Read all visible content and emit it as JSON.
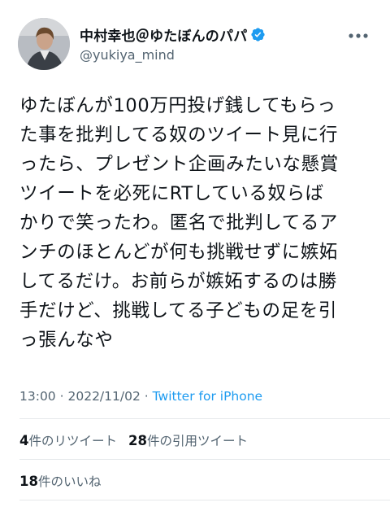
{
  "user": {
    "display_name": "中村幸也＠ゆたぼんのパパ",
    "handle": "@yukiya_mind",
    "verified": true
  },
  "tweet": {
    "text": "ゆたぼんが100万円投げ銭してもらっ\nた事を批判してる奴のツイート見に行\nったら、プレゼント企画みたいな懸賞\nツイートを必死にRTしている奴らば\nかりで笑ったわ。匿名で批判してるア\nンチのほとんどが何も挑戦せずに嫉妬\nしてるだけ。お前らが嫉妬するのは勝\n手だけど、挑戦してる子どもの足を引\nっ張んなや"
  },
  "meta": {
    "time": "13:00",
    "separator1": "·",
    "date": "2022/11/02",
    "separator2": "·",
    "source": "Twitter for iPhone"
  },
  "stats": {
    "retweets_count": "4",
    "retweets_label": "件のリツイート",
    "quotes_count": "28",
    "quotes_label": "件の引用ツイート",
    "likes_count": "18",
    "likes_label": "件のいいね"
  },
  "colors": {
    "link": "#1d9bf0",
    "verified_badge": "#1d9bf0",
    "secondary_text": "#536471",
    "primary_text": "#0f1419",
    "divider": "#e6e9eb"
  },
  "icons": {
    "more": "more-horizontal-icon",
    "verified": "verified-badge-icon"
  }
}
